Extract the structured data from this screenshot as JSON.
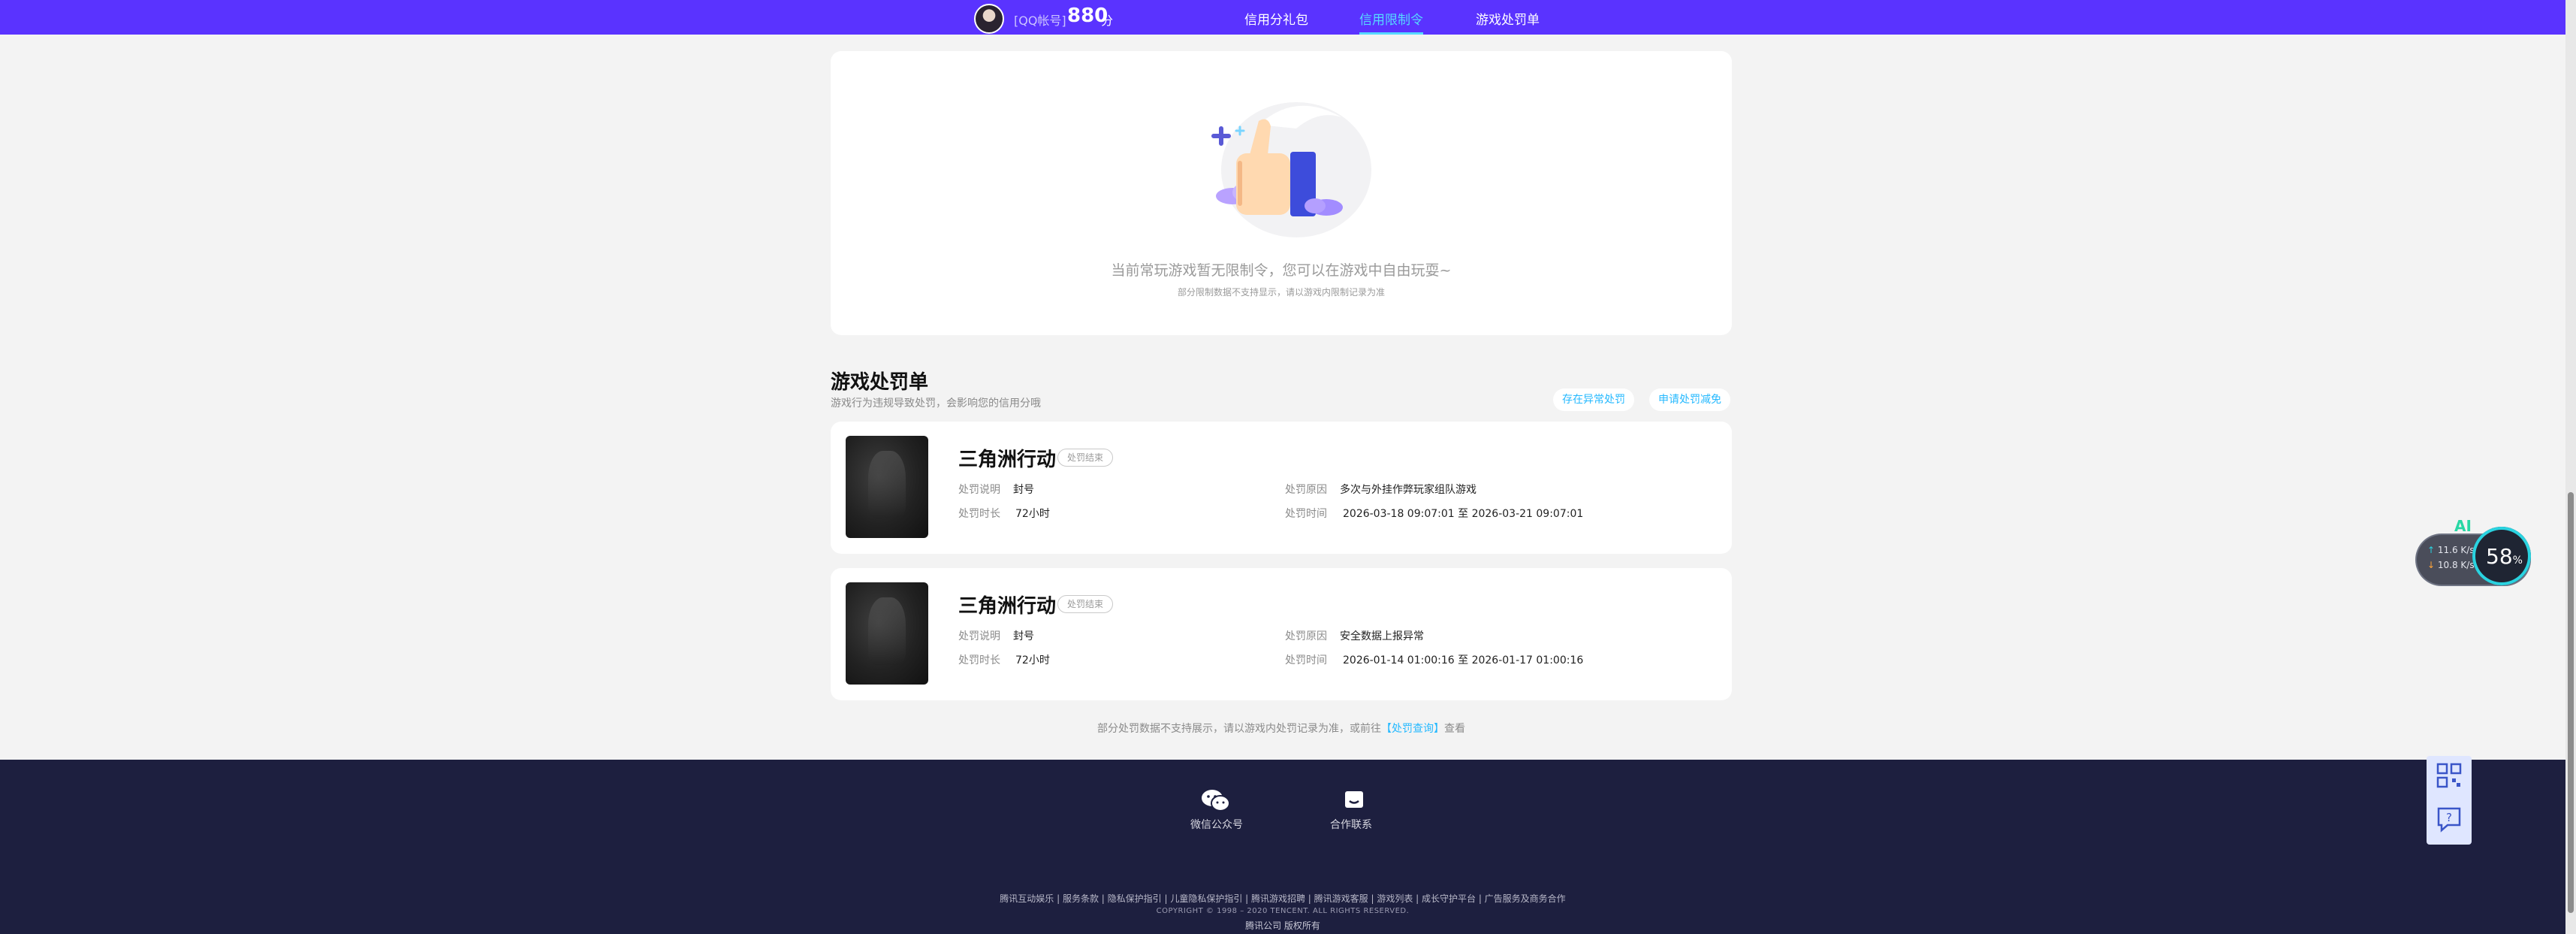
{
  "header": {
    "qq_tag": "[QQ帐号]",
    "score": "880",
    "score_unit": "分",
    "tabs": [
      {
        "label": "信用分礼包",
        "active": false
      },
      {
        "label": "信用限制令",
        "active": true
      },
      {
        "label": "游戏处罚单",
        "active": false
      }
    ]
  },
  "restriction": {
    "empty_main": "当前常玩游戏暂无限制令，您可以在游戏中自由玩耍~",
    "empty_sub": "部分限制数据不支持显示，请以游戏内限制记录为准"
  },
  "penalty": {
    "title": "游戏处罚单",
    "subtitle": "游戏行为违规导致处罚，会影响您的信用分哦",
    "buttons": {
      "report": "存在异常处罚",
      "appeal": "申请处罚减免"
    },
    "labels": {
      "desc": "处罚说明",
      "duration": "处罚时长",
      "reason": "处罚原因",
      "time": "处罚时间"
    },
    "items": [
      {
        "game": "三角洲行动",
        "status": "处罚结束",
        "desc": "封号",
        "duration": "72小时",
        "reason": "多次与外挂作弊玩家组队游戏",
        "time": "2026-03-18 09:07:01 至 2026-03-21 09:07:01"
      },
      {
        "game": "三角洲行动",
        "status": "处罚结束",
        "desc": "封号",
        "duration": "72小时",
        "reason": "安全数据上报异常",
        "time": "2026-01-14 01:00:16 至 2026-01-17 01:00:16"
      }
    ],
    "note_prefix": "部分处罚数据不支持展示，请以游戏内处罚记录为准，或前往",
    "note_link": "【处罚查询】",
    "note_suffix": "查看"
  },
  "footer": {
    "wechat_label": "微信公众号",
    "contact_label": "合作联系",
    "links": "腾讯互动娱乐 | 服务条款 | 隐私保护指引 | 儿童隐私保护指引 | 腾讯游戏招聘 | 腾讯游戏客服 | 游戏列表 | 成长守护平台 | 广告服务及商务合作",
    "copyright": "COPYRIGHT © 1998 – 2020 TENCENT. ALL RIGHTS RESERVED.",
    "owner": "腾讯公司 版权所有"
  },
  "net_widget": {
    "ai": "AI",
    "up": "11.6 K/s",
    "down": "10.8 K/s",
    "percent": "58",
    "percent_unit": "%"
  },
  "colors": {
    "brand": "#5a33ff",
    "accent": "#25b9ff",
    "footer": "#1d1f3f"
  },
  "icons": [
    "avatar",
    "thumbs-up-illustration",
    "wechat-icon",
    "contact-icon",
    "qrcode-icon",
    "help-icon"
  ]
}
